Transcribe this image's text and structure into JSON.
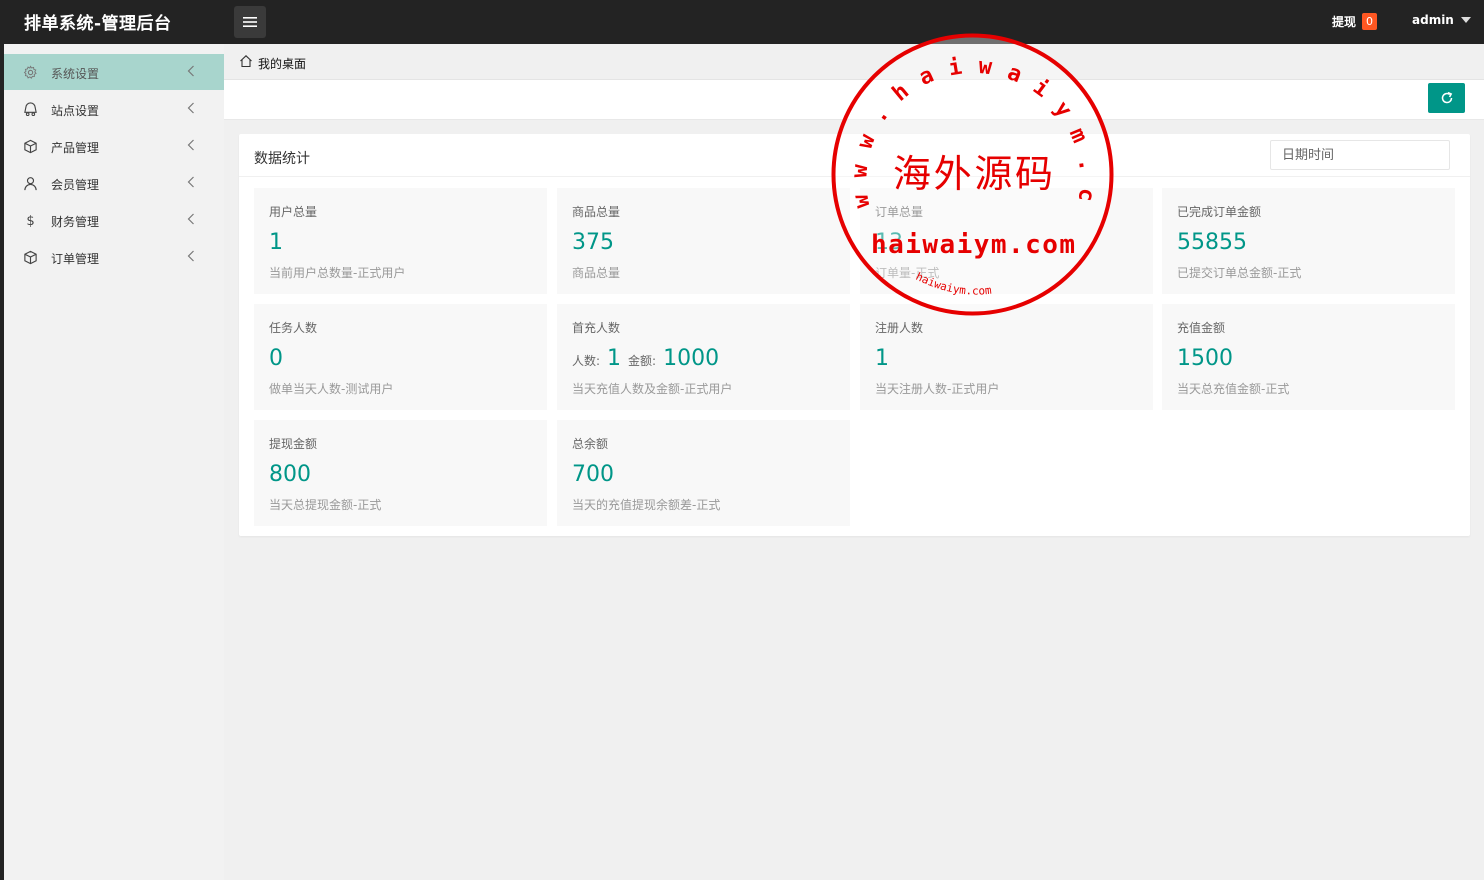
{
  "header": {
    "title": "排单系统-管理后台",
    "withdraw_label": "提现",
    "withdraw_count": "0",
    "user": "admin"
  },
  "sidebar": {
    "items": [
      {
        "label": "系统设置",
        "icon": "gear-icon",
        "active": true
      },
      {
        "label": "站点设置",
        "icon": "site-icon",
        "active": false
      },
      {
        "label": "产品管理",
        "icon": "product-icon",
        "active": false
      },
      {
        "label": "会员管理",
        "icon": "user-icon",
        "active": false
      },
      {
        "label": "财务管理",
        "icon": "dollar-icon",
        "active": false
      },
      {
        "label": "订单管理",
        "icon": "order-icon",
        "active": false
      }
    ]
  },
  "breadcrumb": {
    "label": "我的桌面"
  },
  "panel": {
    "title": "数据统计",
    "date_placeholder": "日期时间"
  },
  "stats": [
    {
      "label": "用户总量",
      "value": "1",
      "desc": "当前用户总数量-正式用户"
    },
    {
      "label": "商品总量",
      "value": "375",
      "desc": "商品总量"
    },
    {
      "label": "订单总量",
      "value": "13",
      "desc": "订单量-正式"
    },
    {
      "label": "已完成订单金额",
      "value": "55855",
      "desc": "已提交订单总金额-正式"
    },
    {
      "label": "任务人数",
      "value": "0",
      "desc": "做单当天人数-测试用户"
    },
    {
      "label": "首充人数",
      "count_label": "人数:",
      "count": "1",
      "amount_label": "金额:",
      "amount": "1000",
      "desc": "当天充值人数及金额-正式用户"
    },
    {
      "label": "注册人数",
      "value": "1",
      "desc": "当天注册人数-正式用户"
    },
    {
      "label": "充值金额",
      "value": "1500",
      "desc": "当天总充值金额-正式"
    },
    {
      "label": "提现金额",
      "value": "800",
      "desc": "当天总提现金额-正式"
    },
    {
      "label": "总余额",
      "value": "700",
      "desc": "当天的充值提现余额差-正式"
    }
  ],
  "watermark": {
    "ring_text": "www.haiwaiym.com",
    "center_text": "海外源码",
    "domain_text": "haiwaiym.com",
    "small_text": "haiwaiym.com",
    "color": "#e60000"
  },
  "colors": {
    "accent": "#009688",
    "badge": "#ff5722",
    "active_bg": "#a8d5cd"
  }
}
